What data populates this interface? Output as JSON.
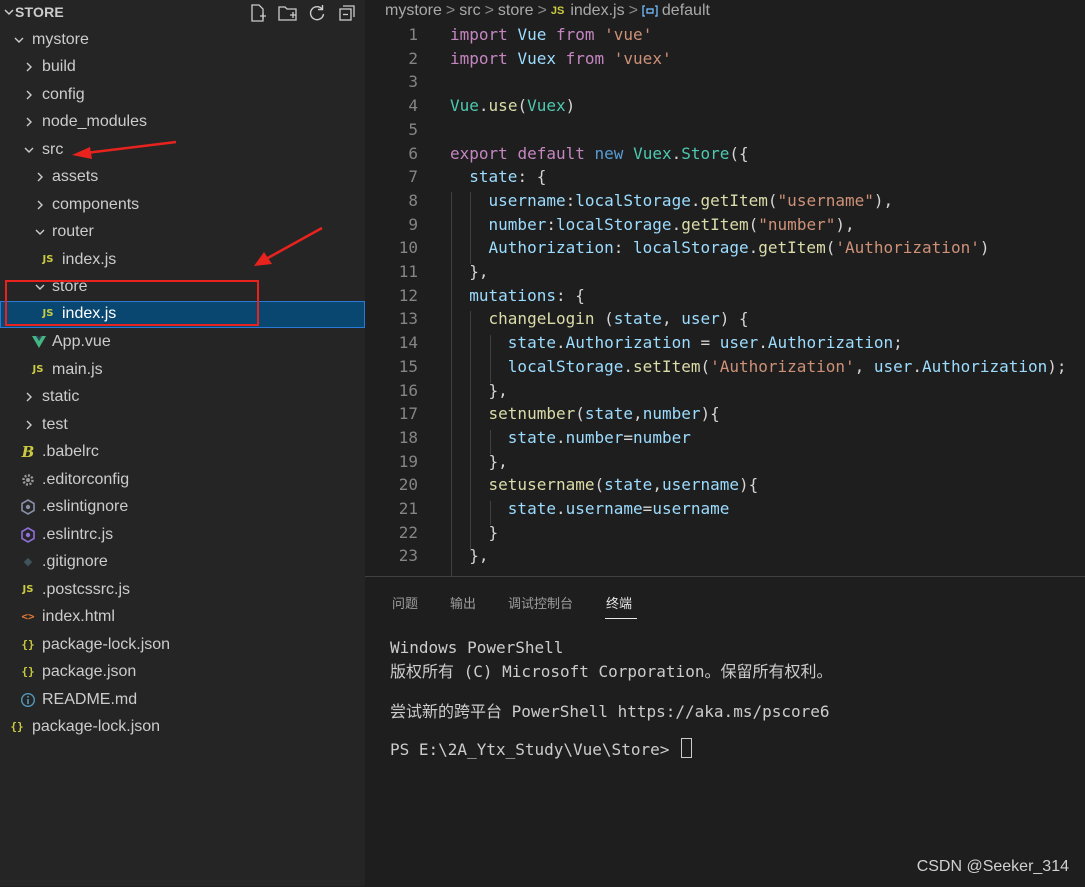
{
  "explorer": {
    "title": "STORE",
    "tree": [
      {
        "label": "mystore",
        "type": "folder-open"
      },
      {
        "label": "build",
        "type": "folder"
      },
      {
        "label": "config",
        "type": "folder"
      },
      {
        "label": "node_modules",
        "type": "folder"
      },
      {
        "label": "src",
        "type": "folder-open"
      },
      {
        "label": "assets",
        "type": "folder"
      },
      {
        "label": "components",
        "type": "folder"
      },
      {
        "label": "router",
        "type": "folder-open"
      },
      {
        "label": "index.js",
        "type": "js-file"
      },
      {
        "label": "store",
        "type": "folder-open"
      },
      {
        "label": "index.js",
        "type": "js-file",
        "selected": true
      },
      {
        "label": "App.vue",
        "type": "vue-file"
      },
      {
        "label": "main.js",
        "type": "js-file"
      },
      {
        "label": "static",
        "type": "folder"
      },
      {
        "label": "test",
        "type": "folder"
      },
      {
        "label": ".babelrc",
        "type": "babel-file"
      },
      {
        "label": ".editorconfig",
        "type": "config-file"
      },
      {
        "label": ".eslintignore",
        "type": "eslint-file"
      },
      {
        "label": ".eslintrc.js",
        "type": "eslint-file"
      },
      {
        "label": ".gitignore",
        "type": "git-file"
      },
      {
        "label": ".postcssrc.js",
        "type": "js-file"
      },
      {
        "label": "index.html",
        "type": "html-file"
      },
      {
        "label": "package-lock.json",
        "type": "json-file"
      },
      {
        "label": "package.json",
        "type": "json-file"
      },
      {
        "label": "README.md",
        "type": "info-file"
      },
      {
        "label": "package-lock.json",
        "type": "json-file"
      }
    ],
    "icons": {
      "js": "JS",
      "json": "{}",
      "html": "<>",
      "babel": "B",
      "info": "i",
      "git": "◆"
    }
  },
  "breadcrumb": {
    "items": [
      "mystore",
      "src",
      "store",
      "index.js",
      "default"
    ],
    "separator": ">"
  },
  "editor": {
    "line_numbers": [
      "1",
      "2",
      "3",
      "4",
      "5",
      "6",
      "7",
      "8",
      "9",
      "10",
      "11",
      "12",
      "13",
      "14",
      "15",
      "16",
      "17",
      "18",
      "19",
      "20",
      "21",
      "22",
      "23"
    ],
    "lines": [
      [
        [
          "kw",
          "import"
        ],
        [
          "t",
          " "
        ],
        [
          "vr",
          "Vue"
        ],
        [
          "t",
          " "
        ],
        [
          "kw",
          "from"
        ],
        [
          "t",
          " "
        ],
        [
          "st",
          "'vue'"
        ]
      ],
      [
        [
          "kw",
          "import"
        ],
        [
          "t",
          " "
        ],
        [
          "vr",
          "Vuex"
        ],
        [
          "t",
          " "
        ],
        [
          "kw",
          "from"
        ],
        [
          "t",
          " "
        ],
        [
          "st",
          "'vuex'"
        ]
      ],
      [],
      [
        [
          "cl",
          "Vue"
        ],
        [
          "t",
          "."
        ],
        [
          "fn",
          "use"
        ],
        [
          "t",
          "("
        ],
        [
          "cl",
          "Vuex"
        ],
        [
          "t",
          ")"
        ]
      ],
      [],
      [
        [
          "kw",
          "export"
        ],
        [
          "t",
          " "
        ],
        [
          "kw",
          "default"
        ],
        [
          "t",
          " "
        ],
        [
          "kb",
          "new"
        ],
        [
          "t",
          " "
        ],
        [
          "cl",
          "Vuex"
        ],
        [
          "t",
          "."
        ],
        [
          "cl",
          "Store"
        ],
        [
          "t",
          "({"
        ]
      ],
      [
        [
          "t",
          "  "
        ],
        [
          "vr",
          "state"
        ],
        [
          "t",
          ": {"
        ]
      ],
      [
        [
          "t",
          "    "
        ],
        [
          "vr",
          "username"
        ],
        [
          "t",
          ":"
        ],
        [
          "vr",
          "localStorage"
        ],
        [
          "t",
          "."
        ],
        [
          "fn",
          "getItem"
        ],
        [
          "t",
          "("
        ],
        [
          "st",
          "\"username\""
        ],
        [
          "t",
          "),"
        ]
      ],
      [
        [
          "t",
          "    "
        ],
        [
          "vr",
          "number"
        ],
        [
          "t",
          ":"
        ],
        [
          "vr",
          "localStorage"
        ],
        [
          "t",
          "."
        ],
        [
          "fn",
          "getItem"
        ],
        [
          "t",
          "("
        ],
        [
          "st",
          "\"number\""
        ],
        [
          "t",
          "),"
        ]
      ],
      [
        [
          "t",
          "    "
        ],
        [
          "vr",
          "Authorization"
        ],
        [
          "t",
          ": "
        ],
        [
          "vr",
          "localStorage"
        ],
        [
          "t",
          "."
        ],
        [
          "fn",
          "getItem"
        ],
        [
          "t",
          "("
        ],
        [
          "st",
          "'Authorization'"
        ],
        [
          "t",
          ")"
        ]
      ],
      [
        [
          "t",
          "  },"
        ]
      ],
      [
        [
          "t",
          "  "
        ],
        [
          "vr",
          "mutations"
        ],
        [
          "t",
          ": {"
        ]
      ],
      [
        [
          "t",
          "    "
        ],
        [
          "fn",
          "changeLogin"
        ],
        [
          "t",
          " ("
        ],
        [
          "vr",
          "state"
        ],
        [
          "t",
          ", "
        ],
        [
          "vr",
          "user"
        ],
        [
          "t",
          ") {"
        ]
      ],
      [
        [
          "t",
          "      "
        ],
        [
          "vr",
          "state"
        ],
        [
          "t",
          "."
        ],
        [
          "vr",
          "Authorization"
        ],
        [
          "t",
          " = "
        ],
        [
          "vr",
          "user"
        ],
        [
          "t",
          "."
        ],
        [
          "vr",
          "Authorization"
        ],
        [
          "t",
          ";"
        ]
      ],
      [
        [
          "t",
          "      "
        ],
        [
          "vr",
          "localStorage"
        ],
        [
          "t",
          "."
        ],
        [
          "fn",
          "setItem"
        ],
        [
          "t",
          "("
        ],
        [
          "st",
          "'Authorization'"
        ],
        [
          "t",
          ", "
        ],
        [
          "vr",
          "user"
        ],
        [
          "t",
          "."
        ],
        [
          "vr",
          "Authorization"
        ],
        [
          "t",
          ");"
        ]
      ],
      [
        [
          "t",
          "    },"
        ]
      ],
      [
        [
          "t",
          "    "
        ],
        [
          "fn",
          "setnumber"
        ],
        [
          "t",
          "("
        ],
        [
          "vr",
          "state"
        ],
        [
          "t",
          ","
        ],
        [
          "vr",
          "number"
        ],
        [
          "t",
          "){"
        ]
      ],
      [
        [
          "t",
          "      "
        ],
        [
          "vr",
          "state"
        ],
        [
          "t",
          "."
        ],
        [
          "vr",
          "number"
        ],
        [
          "t",
          "="
        ],
        [
          "vr",
          "number"
        ]
      ],
      [
        [
          "t",
          "    },"
        ]
      ],
      [
        [
          "t",
          "    "
        ],
        [
          "fn",
          "setusername"
        ],
        [
          "t",
          "("
        ],
        [
          "vr",
          "state"
        ],
        [
          "t",
          ","
        ],
        [
          "vr",
          "username"
        ],
        [
          "t",
          "){"
        ]
      ],
      [
        [
          "t",
          "      "
        ],
        [
          "vr",
          "state"
        ],
        [
          "t",
          "."
        ],
        [
          "vr",
          "username"
        ],
        [
          "t",
          "="
        ],
        [
          "vr",
          "username"
        ]
      ],
      [
        [
          "t",
          "    }"
        ]
      ],
      [
        [
          "t",
          "  },"
        ]
      ]
    ]
  },
  "panel": {
    "tabs": [
      "问题",
      "输出",
      "调试控制台",
      "终端"
    ],
    "active_tab": "终端",
    "terminal": {
      "line1": "Windows PowerShell",
      "line2": "版权所有 (C) Microsoft Corporation。保留所有权利。",
      "line3": "尝试新的跨平台 PowerShell https://aka.ms/pscore6",
      "prompt": "PS E:\\2A_Ytx_Study\\Vue\\Store> "
    }
  },
  "watermark": "CSDN @Seeker_314",
  "colors": {
    "selection": "#094771",
    "annotation_red": "#e8231e",
    "keyword": "#c586c0",
    "string": "#ce9178",
    "function": "#dcdcaa",
    "variable": "#9cdcfe"
  }
}
